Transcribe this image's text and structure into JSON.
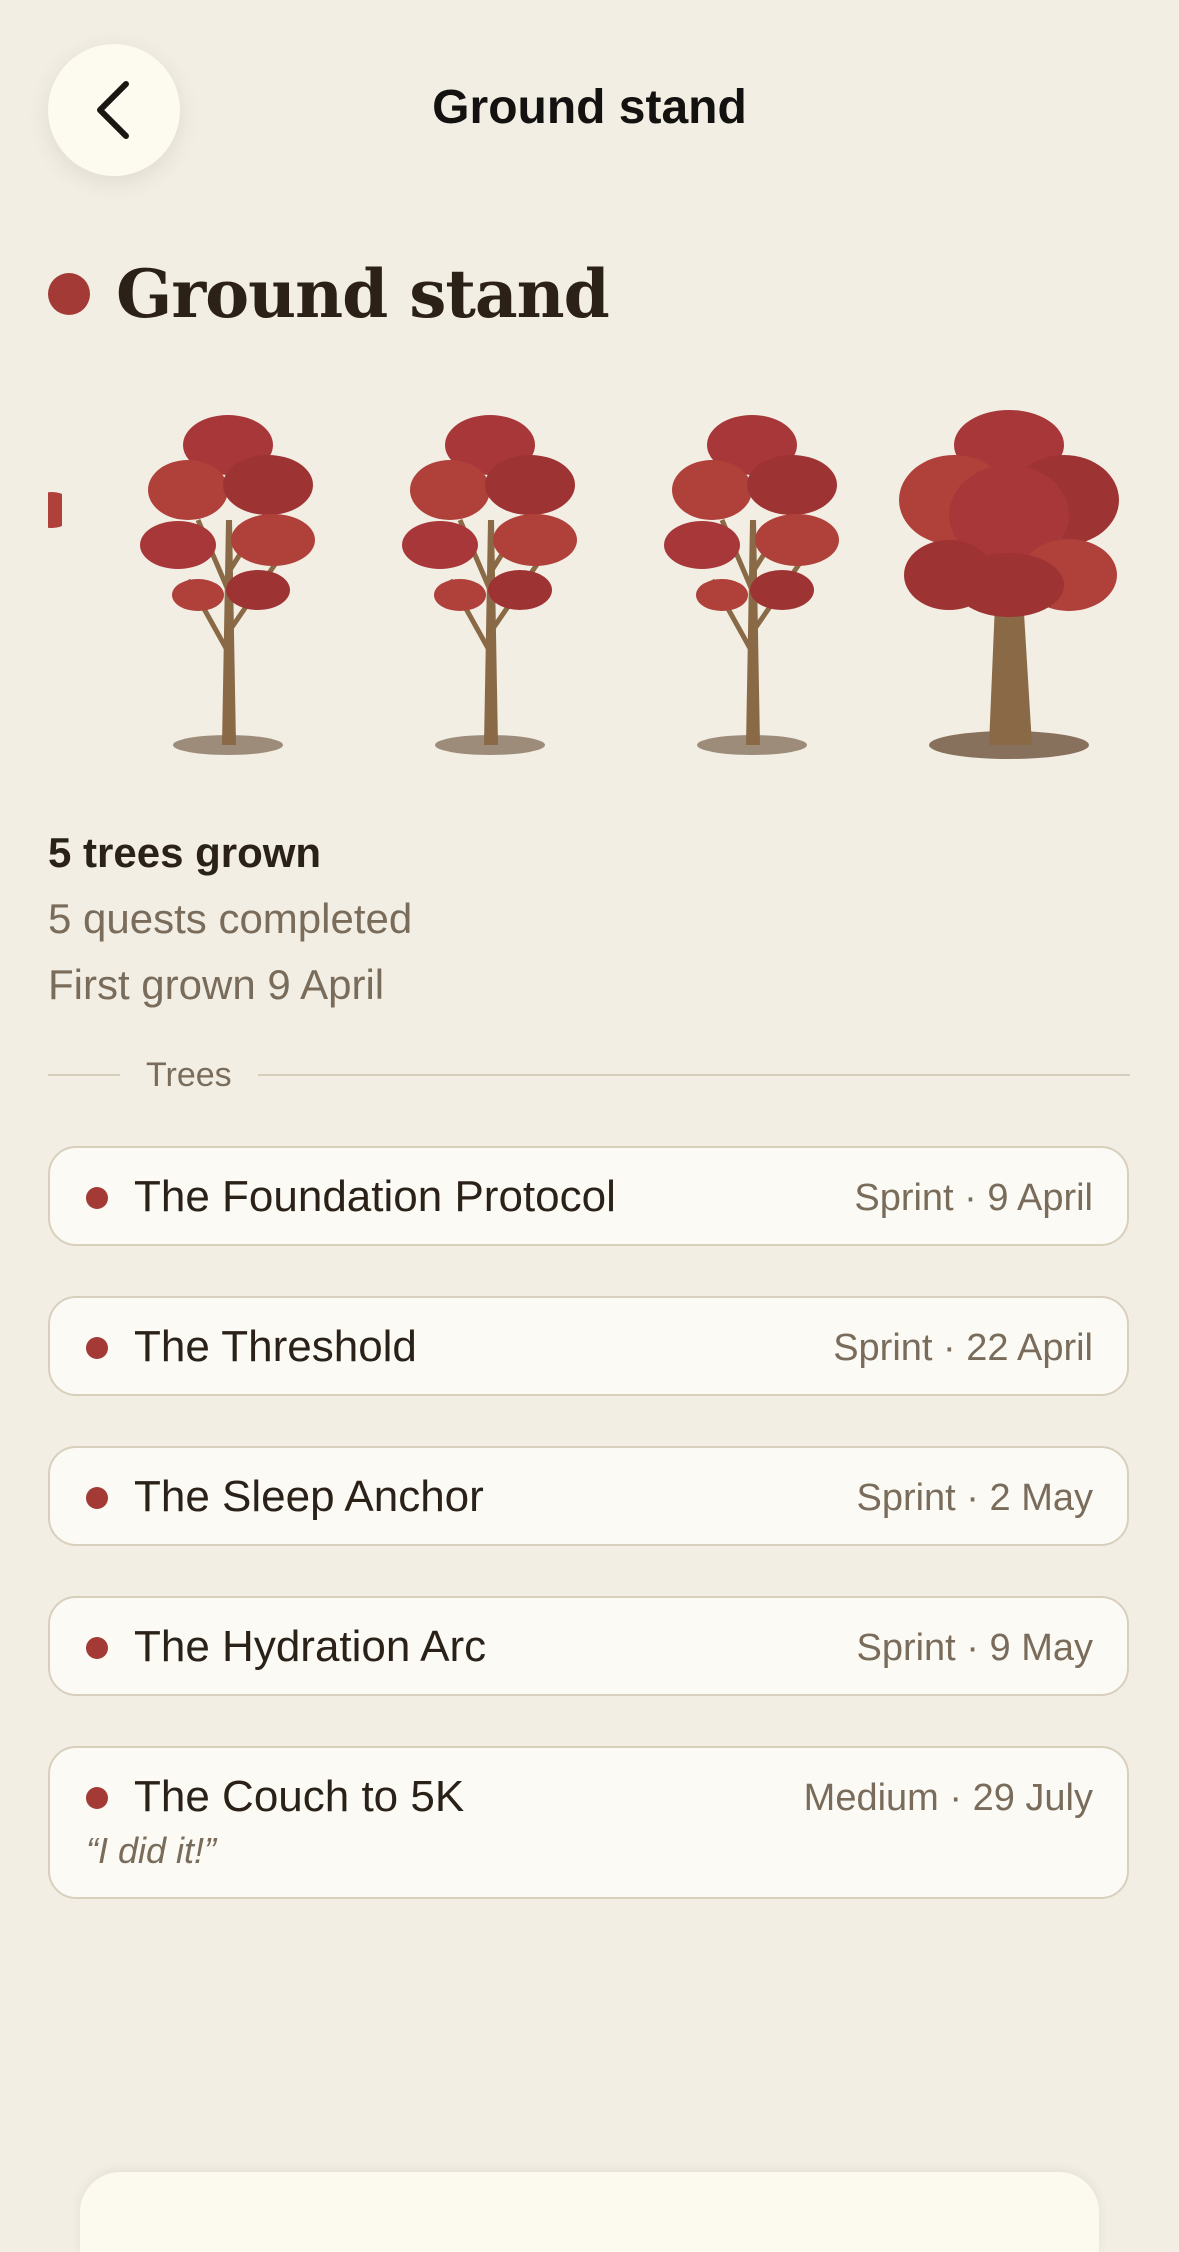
{
  "header": {
    "title": "Ground stand"
  },
  "stand": {
    "name": "Ground stand",
    "accent_color": "#a33a36",
    "stats": {
      "trees_grown": "5 trees grown",
      "quests_completed": "5 quests completed",
      "first_grown": "First grown 9 April"
    }
  },
  "section": {
    "label": "Trees"
  },
  "trees": [
    {
      "name": "The Foundation Protocol",
      "meta": "Sprint · 9 April"
    },
    {
      "name": "The Threshold",
      "meta": "Sprint · 22 April"
    },
    {
      "name": "The Sleep Anchor",
      "meta": "Sprint · 2 May"
    },
    {
      "name": "The Hydration Arc",
      "meta": "Sprint · 9 May"
    },
    {
      "name": "The Couch to 5K",
      "meta": "Medium · 29 July",
      "quote": "“I did it!”"
    }
  ]
}
